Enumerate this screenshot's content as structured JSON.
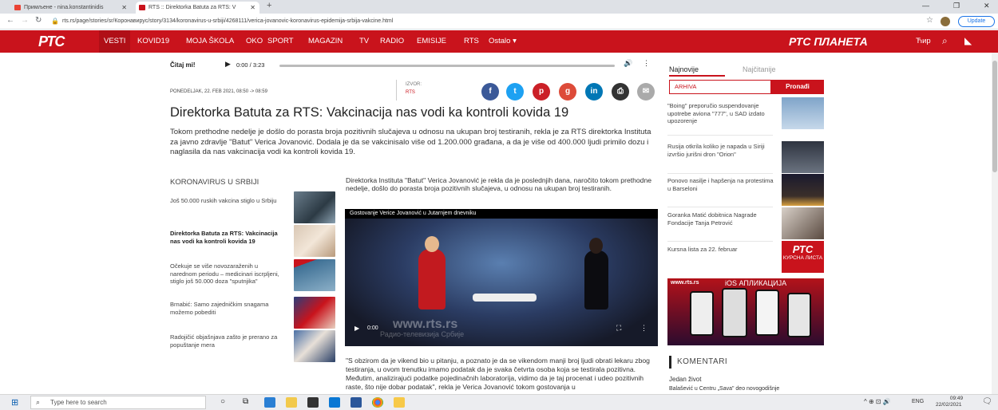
{
  "browser": {
    "tabs": [
      {
        "label": "Примљене - nina.konstantinidis",
        "close": "✕"
      },
      {
        "label": "RTS :: Direktorka Batuta za RTS: V",
        "close": "✕"
      }
    ],
    "new_tab": "+",
    "url": "rts.rs/page/stories/sr/Коронавирус/story/3134/koronavirus-u-srbiji/4268111/verica-jovanovic-koronavirus-epidemija-srbija-vakcine.html",
    "update_label": "Update",
    "window_controls": {
      "minimize": "—",
      "restore": "❐",
      "close": "✕"
    }
  },
  "rts_nav": {
    "logo": "РТС",
    "items": [
      "VESTI",
      "KOVID19",
      "MOJA ŠKOLA",
      "OKO",
      "SPORT",
      "MAGAZIN",
      "TV",
      "RADIO",
      "EMISIJE",
      "RTS",
      "Ostalo ▾"
    ],
    "planeta": "РТС ПЛАНЕТА",
    "script_toggle": "Ћир"
  },
  "audio": {
    "label": "Čitaj mi!",
    "time": "0:00 / 3:23"
  },
  "article": {
    "date": "PONEDELJAK, 22. FEB 2021, 08:50 -> 08:59",
    "source_label": "IZVOR:",
    "source": "RTS",
    "title": "Direktorka Batuta za RTS: Vakcinacija nas vodi ka kontroli kovida 19",
    "lead": "Tokom prethodne nedelje je došlo do porasta broja pozitivnih slučajeva u odnosu na ukupan broj testiranih, rekla je za RTS direktorka Instituta za javno zdravlje \"Batut\" Verica Jovanović. Dodala je da se vakcinisalo više od 1.200.000 građana, a da je više od 400.000 ljudi primilo dozu i naglasila da nas vakcinacija vodi ka kontroli kovida 19.",
    "body1": "Direktorka Instituta \"Batut\" Verica Jovanović je rekla da je poslednjih dana, naročito tokom prethodne nedelje, došlo do porasta broja pozitivnih slučajeva, u odnosu na ukupan broj testiranih.",
    "video_caption": "Gostovanje Verice Jovanović u Jutarnjem dnevniku",
    "video_time": "0:00",
    "watermark": "www.rts.rs",
    "watermark2": "Радио-телевизија Србије",
    "body2": "\"S obzirom da je vikend bio u pitanju, a poznato je da se vikendom manji broj ljudi obrati lekaru zbog testiranja, u ovom trenutku imamo podatak da je svaka četvrta osoba koja se testirala pozitivna. Međutim, analizirajući podatke pojedinačnih laboratorija, vidimo da je taj procenat i udeo pozitivnih raste, što nije dobar podatak\", rekla je Verica Jovanović tokom gostovanja u"
  },
  "related": {
    "heading": "KORONAVIRUS U SRBIJI",
    "items": [
      "Još 50.000 ruskih vakcina stiglo u Srbiju",
      "Direktorka Batuta za RTS: Vakcinacija nas vodi ka kontroli kovida 19",
      "Očekuje se više novozaraženih u narednom periodu – medicinari iscrpljeni, stiglo još 50.000 doza \"sputnjika\"",
      "Brnabić: Samo zajedničkim snagama možemo pobediti",
      "Radojičić objašnjava zašto je prerano za popuštanje mera"
    ]
  },
  "sidebar": {
    "tabs": [
      "Najnovije",
      "Najčitanije"
    ],
    "search_placeholder": "ARHIVA",
    "search_button": "Pronađi",
    "news": [
      "\"Boing\" preporučio suspendovanje upotrebe aviona \"777\", u SAD izdato upozorenje",
      "Rusija otkrila koliko je napada u Siriji izvršio jurišni dron \"Orion\"",
      "Ponovo nasilje i hapšenja na protestima u Barseloni",
      "Goranka Matić dobitnica Nagrade Fondacije Tanja Petrović",
      "Kursna lista za 22. februar"
    ],
    "kursna_badge": "КУРСНА ЛИСТА",
    "ios_site": "www.rts.rs",
    "ios_title": "iOS АПЛИКАЦИЈА",
    "comments_heading": "KOMENTARI",
    "comment_author": "Jedan život",
    "comment_text": "Balašević u Centru „Sava\" deo novogodišnje"
  },
  "taskbar": {
    "search_placeholder": "Type here to search",
    "lang": "ENG",
    "time": "09:49",
    "date": "22/02/2021"
  }
}
